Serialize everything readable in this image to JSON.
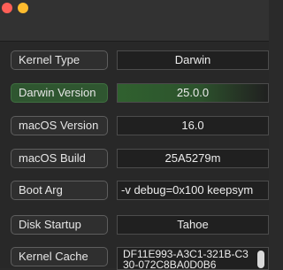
{
  "window": {
    "traffic_lights": [
      {
        "name": "close",
        "color": "#ff5f57"
      },
      {
        "name": "minimize",
        "color": "#febc2e"
      }
    ]
  },
  "rows": [
    {
      "label": "Kernel Type",
      "value": "Darwin"
    },
    {
      "label": "Darwin Version",
      "value": "25.0.0",
      "highlighted": true
    },
    {
      "label": "macOS Version",
      "value": "16.0"
    },
    {
      "label": "macOS Build",
      "value": "25A5279m"
    },
    {
      "label": "Boot Arg",
      "value": "-v debug=0x100 keepsym"
    },
    {
      "label": "Disk Startup",
      "value": "Tahoe"
    },
    {
      "label": "Kernel Cache",
      "value": "DF11E993-A3C1-321B-C330-072C8BA0D0B6"
    }
  ],
  "colors": {
    "window_background": "#282828",
    "highlight_green": "#2f5630"
  }
}
